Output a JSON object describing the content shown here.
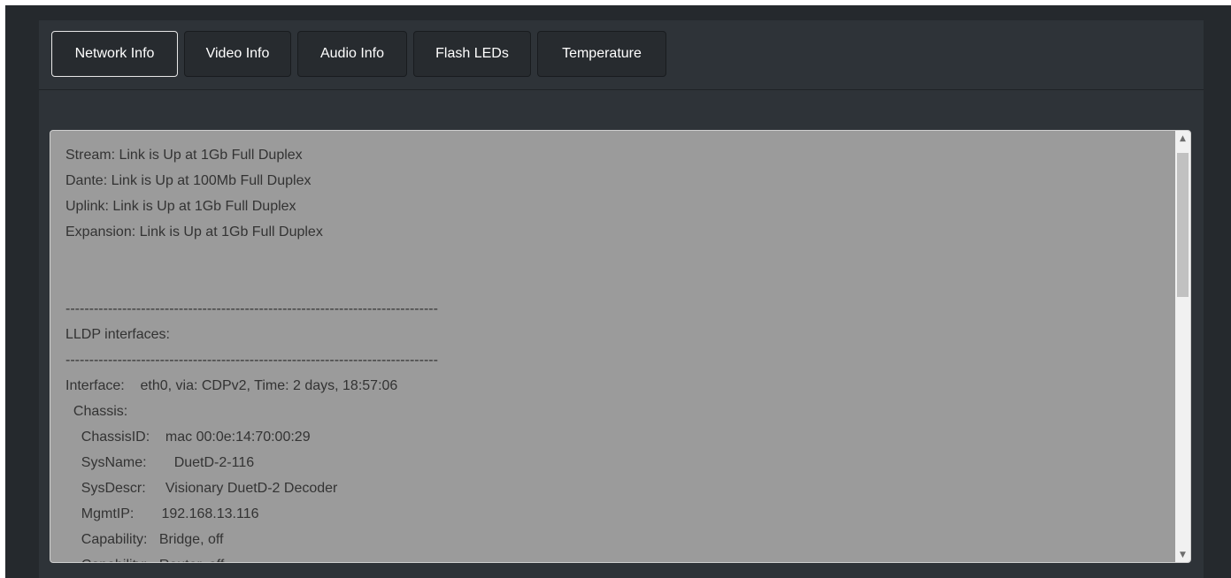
{
  "tabs": [
    {
      "label": "Network Info",
      "active": true
    },
    {
      "label": "Video Info",
      "active": false
    },
    {
      "label": "Audio Info",
      "active": false
    },
    {
      "label": "Flash LEDs",
      "active": false
    },
    {
      "label": "Temperature",
      "active": false
    }
  ],
  "output": {
    "lines": [
      "Stream: Link is Up at 1Gb Full Duplex",
      "Dante: Link is Up at 100Mb Full Duplex",
      "Uplink: Link is Up at 1Gb Full Duplex",
      "Expansion: Link is Up at 1Gb Full Duplex",
      "",
      "",
      "-------------------------------------------------------------------------------",
      "LLDP interfaces:",
      "-------------------------------------------------------------------------------",
      "Interface:    eth0, via: CDPv2, Time: 2 days, 18:57:06",
      "  Chassis:",
      "    ChassisID:    mac 00:0e:14:70:00:29",
      "    SysName:       DuetD-2-116",
      "    SysDescr:     Visionary DuetD-2 Decoder",
      "    MgmtIP:       192.168.13.116",
      "    Capability:   Bridge, off",
      "    Capability:   Router, off"
    ]
  },
  "scrollbar": {
    "up_icon": "▲",
    "down_icon": "▼"
  }
}
